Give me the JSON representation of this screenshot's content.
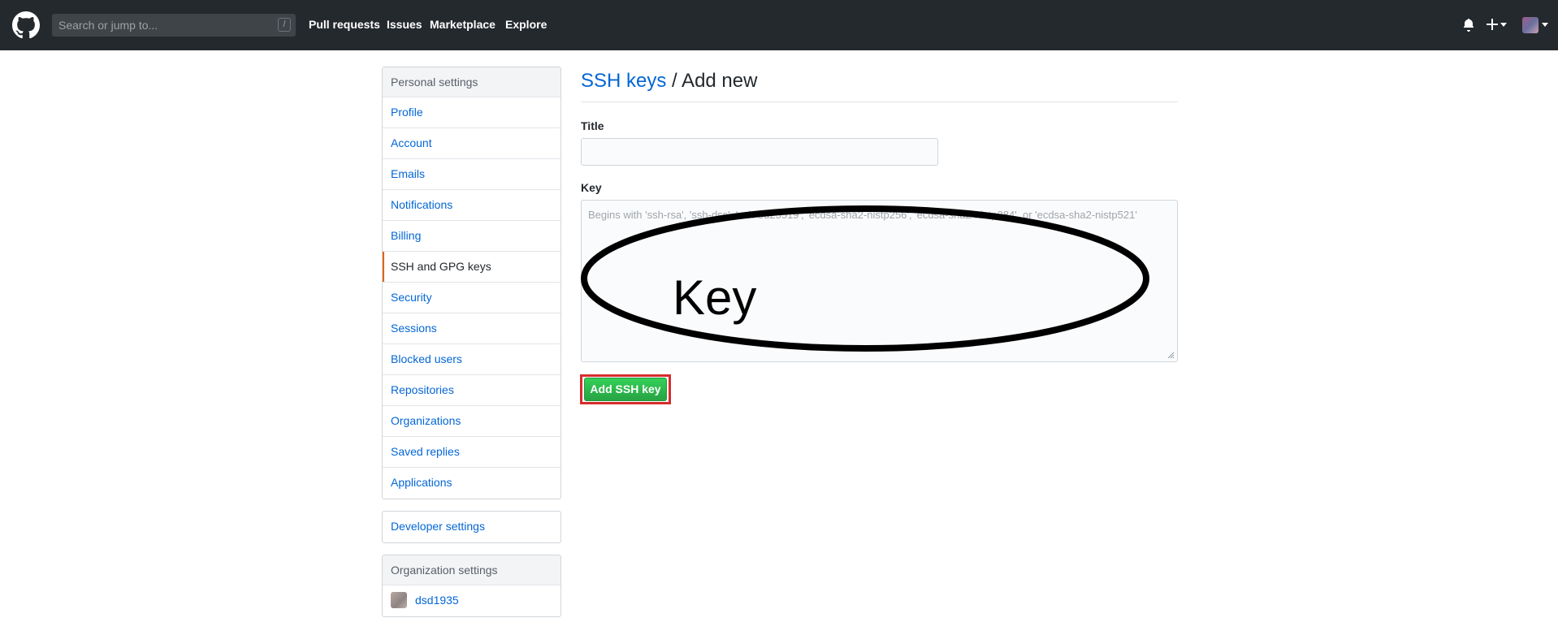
{
  "header": {
    "search_placeholder": "Search or jump to...",
    "search_shortcut": "/",
    "nav": [
      "Pull requests",
      "Issues",
      "Marketplace",
      "Explore"
    ]
  },
  "sidebar": {
    "personal_heading": "Personal settings",
    "items": [
      "Profile",
      "Account",
      "Emails",
      "Notifications",
      "Billing",
      "SSH and GPG keys",
      "Security",
      "Sessions",
      "Blocked users",
      "Repositories",
      "Organizations",
      "Saved replies",
      "Applications"
    ],
    "selected_item": "SSH and GPG keys",
    "developer_settings": "Developer settings",
    "org_heading": "Organization settings",
    "org_name": "dsd1935"
  },
  "main": {
    "breadcrumb_link": "SSH keys",
    "breadcrumb_rest": " / Add new",
    "title_label": "Title",
    "title_value": "",
    "key_label": "Key",
    "key_placeholder": "Begins with 'ssh-rsa', 'ssh-dss', 'ssh-ed25519', 'ecdsa-sha2-nistp256', 'ecdsa-sha2-nistp384', or 'ecdsa-sha2-nistp521'",
    "annotation_text": "Key",
    "submit_label": "Add SSH key"
  },
  "colors": {
    "header_bg": "#24292e",
    "link": "#0366d6",
    "selected_marker": "#e36209",
    "button_green": "#2cbe4e",
    "highlight_red": "#d62c2c"
  },
  "icons": [
    "github-logo-icon",
    "bell-icon",
    "plus-icon",
    "chevron-down-icon",
    "avatar-icon",
    "resize-grip-icon"
  ]
}
